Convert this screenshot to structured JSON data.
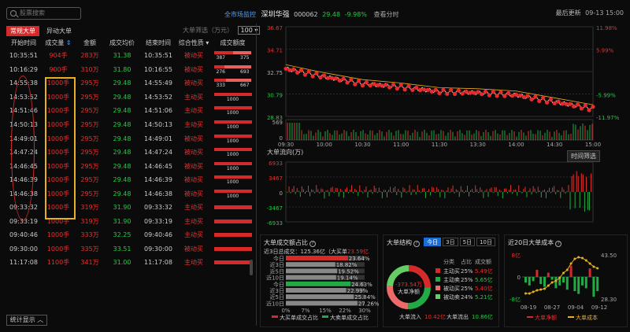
{
  "search": {
    "placeholder": "股票搜索"
  },
  "header": {
    "link": "全市场监控",
    "stock_name": "深圳华强",
    "stock_code": "000062",
    "price": "29.48",
    "change": "-9.98%",
    "view_time": "查看分时"
  },
  "update": {
    "label": "最后更新",
    "time": "09-13 15:00"
  },
  "tabs": [
    {
      "label": "常规大单",
      "active": true
    },
    {
      "label": "异动大单",
      "active": false
    }
  ],
  "filter": {
    "label": "大单筛选（万元）",
    "value": "100"
  },
  "columns": [
    "开始时间",
    "成交量",
    "金额",
    "成交均价",
    "结束时间",
    "综合性质",
    "成交额度"
  ],
  "rows": [
    {
      "t": "10:35:51",
      "v": "904手",
      "m": "283万",
      "p": "31.38",
      "e": "10:35:51",
      "n": "被动买",
      "bar": "split",
      "a": "387",
      "b": "375"
    },
    {
      "t": "10:16:29",
      "v": "900手",
      "m": "310万",
      "p": "31.80",
      "e": "10:16:55",
      "n": "被动买",
      "bar": "split",
      "a": "276",
      "b": "693"
    },
    {
      "t": "14:55:38",
      "v": "1000手",
      "m": "295万",
      "p": "29.48",
      "e": "14:55:49",
      "n": "被动买",
      "bar": "split",
      "a": "333",
      "b": "667"
    },
    {
      "t": "14:53:52",
      "v": "1000手",
      "m": "295万",
      "p": "29.48",
      "e": "14:53:52",
      "n": "主动买",
      "bar": "lbl",
      "a": "1000"
    },
    {
      "t": "14:51:46",
      "v": "1000手",
      "m": "295万",
      "p": "29.48",
      "e": "14:51:06",
      "n": "主动买",
      "bar": "lbl",
      "a": "1000"
    },
    {
      "t": "14:50:13",
      "v": "1000手",
      "m": "295万",
      "p": "29.48",
      "e": "14:50:13",
      "n": "主动买",
      "bar": "lbl",
      "a": "1000"
    },
    {
      "t": "14:49:01",
      "v": "1000手",
      "m": "295万",
      "p": "29.48",
      "e": "14:49:01",
      "n": "被动买",
      "bar": "lbl",
      "a": "1000"
    },
    {
      "t": "14:47:24",
      "v": "1000手",
      "m": "295万",
      "p": "29.48",
      "e": "14:47:24",
      "n": "被动买",
      "bar": "lbl",
      "a": "1000"
    },
    {
      "t": "14:46:45",
      "v": "1000手",
      "m": "295万",
      "p": "29.48",
      "e": "14:46:45",
      "n": "被动买",
      "bar": "lbl",
      "a": "1000"
    },
    {
      "t": "14:46:39",
      "v": "1000手",
      "m": "295万",
      "p": "29.48",
      "e": "14:46:39",
      "n": "被动买",
      "bar": "lbl",
      "a": "1000"
    },
    {
      "t": "14:46:38",
      "v": "1000手",
      "m": "295万",
      "p": "29.48",
      "e": "14:46:38",
      "n": "被动买",
      "bar": "lbl",
      "a": "1000"
    },
    {
      "t": "09:33:32",
      "v": "1000手",
      "m": "319万",
      "p": "31.90",
      "e": "09:33:32",
      "n": "主动买",
      "bar": "plain"
    },
    {
      "t": "09:33:19",
      "v": "1000手",
      "m": "319万",
      "p": "31.90",
      "e": "09:33:19",
      "n": "主动买",
      "bar": "plain"
    },
    {
      "t": "09:40:46",
      "v": "1000手",
      "m": "333万",
      "p": "32.25",
      "e": "09:40:46",
      "n": "主动买",
      "bar": "plain"
    },
    {
      "t": "09:30:00",
      "v": "1000手",
      "m": "335万",
      "p": "33.51",
      "e": "09:30:00",
      "n": "被动买",
      "bar": "plain"
    },
    {
      "t": "11:17:08",
      "v": "1100手",
      "m": "341万",
      "p": "31.00",
      "e": "11:17:08",
      "n": "主动买",
      "bar": "plain"
    }
  ],
  "stat_button": "统计显示",
  "intraday": {
    "y_left": [
      "36.67",
      "34.71",
      "32.75",
      "30.79",
      "28.83"
    ],
    "y_right": [
      "11.98%",
      "5.99%",
      "",
      "-5.99%",
      "-11.97%"
    ],
    "vol_label": "569",
    "vol_label0": "0",
    "x_ticks": [
      "09:30",
      "10:00",
      "10:30",
      "11:00",
      "11:30",
      "13:30",
      "14:00",
      "14:30",
      "15:00"
    ],
    "flow_title": "大单流向(万)",
    "flow_y": [
      "6933",
      "3467",
      "0",
      "-3467",
      "-6933"
    ],
    "time_btn": "时间筛选"
  },
  "panel1": {
    "title": "大单成交额占比",
    "summary": "近3日总成交：125.36亿（大买单",
    "summary_red": "23.59亿",
    "rows": [
      {
        "lbl": "今日",
        "pct": "23.64%"
      },
      {
        "lbl": "近3日",
        "pct": "18.82%"
      },
      {
        "lbl": "近5日",
        "pct": "19.52%"
      },
      {
        "lbl": "近10日",
        "pct": "19.14%"
      },
      {
        "lbl": "今日",
        "pct": "24.63%"
      },
      {
        "lbl": "近3日",
        "pct": "22.99%"
      },
      {
        "lbl": "近5日",
        "pct": "25.84%"
      },
      {
        "lbl": "近10日",
        "pct": "27.26%"
      }
    ],
    "xticks": [
      "0%",
      "7%",
      "15%",
      "22%",
      "30%"
    ],
    "leg1": "大买单成交占比",
    "leg2": "大卖单成交占比"
  },
  "panel2": {
    "title": "大单结构",
    "btns": [
      "今日",
      "3日",
      "5日",
      "10日"
    ],
    "center_val": "-373.54万",
    "center_lbl": "大单净额",
    "head": [
      "分类",
      "占比",
      "成交额"
    ],
    "items": [
      {
        "n": "主动买",
        "p": "25%",
        "a": "5.49亿",
        "c": "#d42a2a"
      },
      {
        "n": "主动卖",
        "p": "25%",
        "a": "5.65亿",
        "c": "#22aa44"
      },
      {
        "n": "被动买",
        "p": "25%",
        "a": "5.40亿",
        "c": "#ee6a6a"
      },
      {
        "n": "被动卖",
        "p": "24%",
        "a": "5.21亿",
        "c": "#66cc66"
      }
    ],
    "in_lbl": "大单流入",
    "in_val": "10.42亿",
    "out_lbl": "大单流出",
    "out_val": "10.86亿"
  },
  "panel3": {
    "title": "近20日大单成本",
    "y_left": [
      "8亿",
      "0",
      "-8亿"
    ],
    "y_right": [
      "43.50",
      "28.30"
    ],
    "x": [
      "08-19",
      "08-27",
      "09-04",
      "09-12"
    ],
    "leg1": "大单净额",
    "leg2": "大单成本"
  },
  "chart_data": [
    {
      "type": "line",
      "title": "",
      "x": [
        "09:30",
        "10:00",
        "10:30",
        "11:00",
        "11:30",
        "13:30",
        "14:00",
        "14:30",
        "15:00"
      ],
      "series": [
        {
          "name": "",
          "values": [
            33.0,
            32.3,
            31.7,
            31.4,
            31.0,
            30.9,
            30.7,
            30.1,
            29.5
          ]
        }
      ],
      "ylim": [
        28.83,
        36.67
      ]
    },
    {
      "type": "bar",
      "title": "大单流向(万)",
      "ylim": [
        -6933,
        6933
      ]
    },
    {
      "type": "bar",
      "title": "大单成交额占比",
      "categories": [
        "今日",
        "近3日",
        "近5日",
        "近10日"
      ],
      "series": [
        {
          "name": "大买单成交占比",
          "values": [
            23.64,
            18.82,
            19.52,
            19.14
          ]
        },
        {
          "name": "大卖单成交占比",
          "values": [
            24.63,
            22.99,
            25.84,
            27.26
          ]
        }
      ]
    },
    {
      "type": "pie",
      "title": "大单结构",
      "categories": [
        "主动买",
        "主动卖",
        "被动买",
        "被动卖"
      ],
      "values": [
        25,
        25,
        25,
        24
      ]
    },
    {
      "type": "bar",
      "title": "近20日大单成本",
      "x": [
        "08-19",
        "08-27",
        "09-04",
        "09-12"
      ]
    }
  ]
}
